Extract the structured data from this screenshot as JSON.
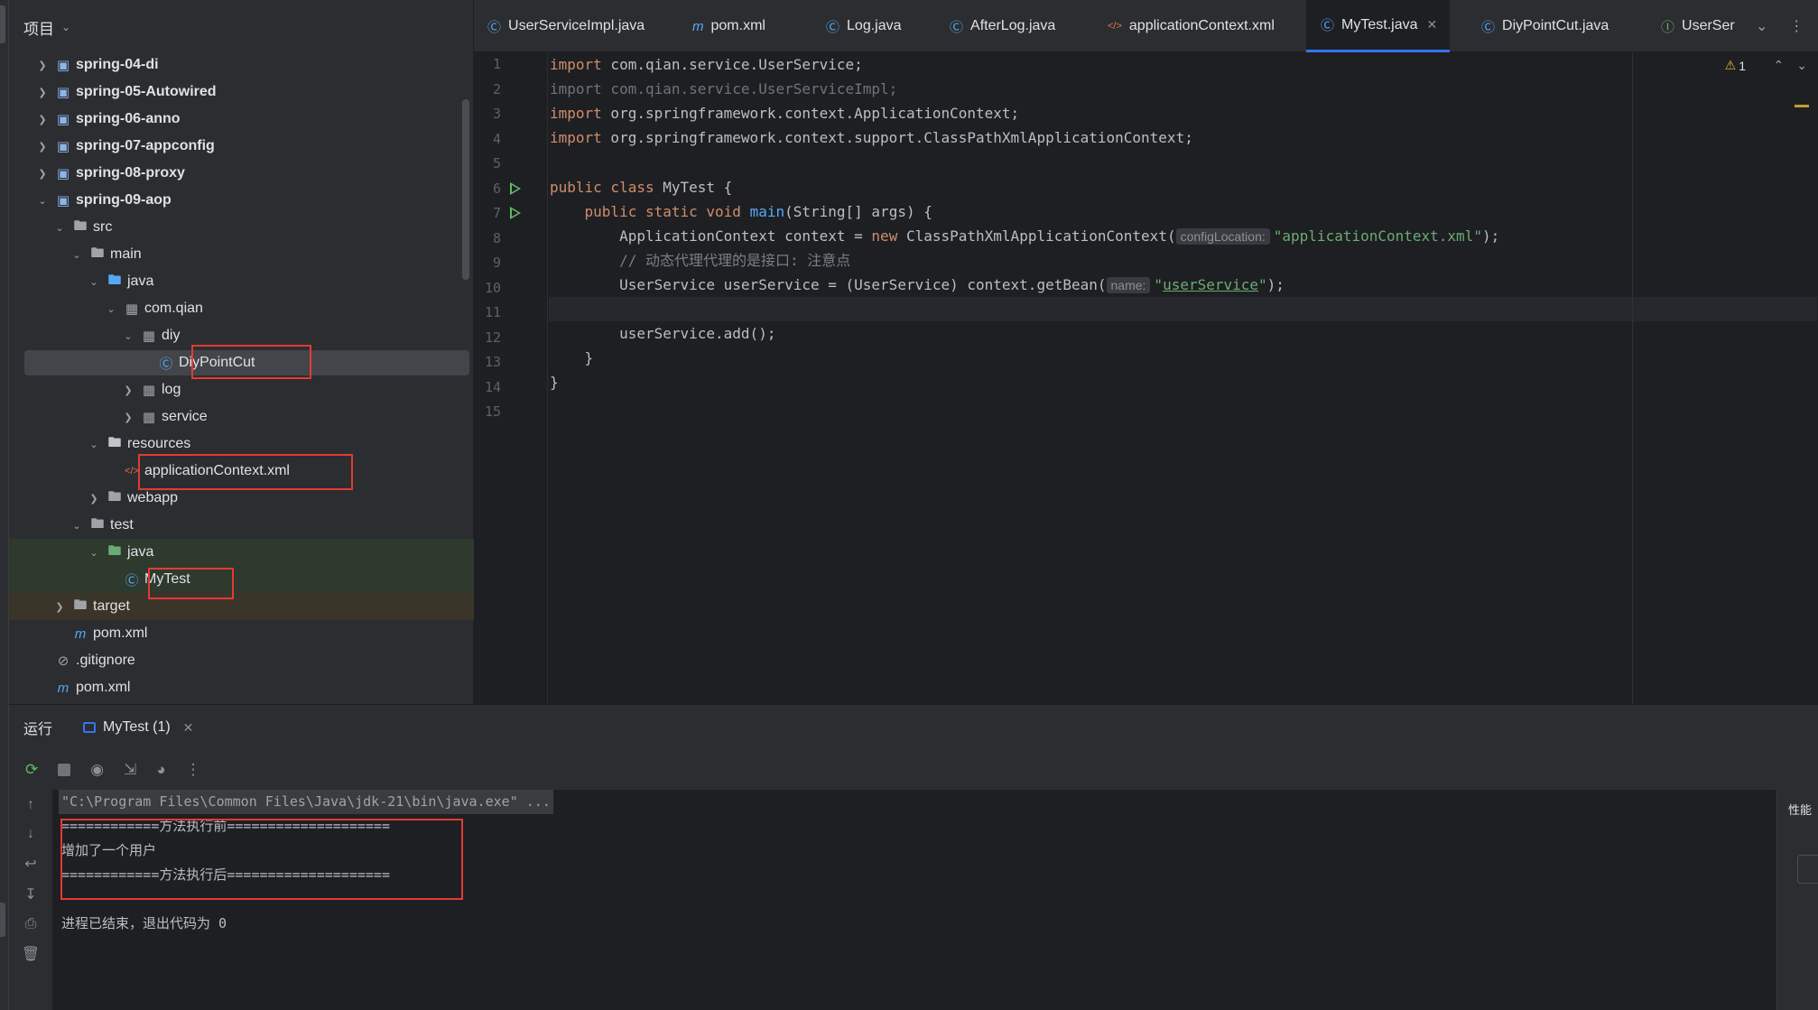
{
  "project": {
    "title": "项目",
    "tree": [
      {
        "label": "spring-04-di",
        "bold": true,
        "indent": 0,
        "arrow": "right",
        "icon": "module-icon"
      },
      {
        "label": "spring-05-Autowired",
        "bold": true,
        "indent": 0,
        "arrow": "right",
        "icon": "module-icon"
      },
      {
        "label": "spring-06-anno",
        "bold": true,
        "indent": 0,
        "arrow": "right",
        "icon": "module-icon"
      },
      {
        "label": "spring-07-appconfig",
        "bold": true,
        "indent": 0,
        "arrow": "right",
        "icon": "module-icon"
      },
      {
        "label": "spring-08-proxy",
        "bold": true,
        "indent": 0,
        "arrow": "right",
        "icon": "module-icon"
      },
      {
        "label": "spring-09-aop",
        "bold": true,
        "indent": 0,
        "arrow": "down",
        "icon": "module-icon"
      },
      {
        "label": "src",
        "indent": 1,
        "arrow": "down",
        "icon": "folder-icon"
      },
      {
        "label": "main",
        "indent": 2,
        "arrow": "down",
        "icon": "folder-icon"
      },
      {
        "label": "java",
        "indent": 3,
        "arrow": "down",
        "icon": "source-folder-icon"
      },
      {
        "label": "com.qian",
        "indent": 4,
        "arrow": "down",
        "icon": "package-icon"
      },
      {
        "label": "diy",
        "indent": 5,
        "arrow": "down",
        "icon": "package-icon"
      },
      {
        "label": "DiyPointCut",
        "indent": 6,
        "arrow": "",
        "icon": "java-class-icon",
        "selected": true
      },
      {
        "label": "log",
        "indent": 5,
        "arrow": "right",
        "icon": "package-icon"
      },
      {
        "label": "service",
        "indent": 5,
        "arrow": "right",
        "icon": "package-icon"
      },
      {
        "label": "resources",
        "indent": 3,
        "arrow": "down",
        "icon": "resources-folder-icon"
      },
      {
        "label": "applicationContext.xml",
        "indent": 4,
        "arrow": "",
        "icon": "xml-file-icon"
      },
      {
        "label": "webapp",
        "indent": 3,
        "arrow": "right",
        "icon": "web-folder-icon"
      },
      {
        "label": "test",
        "indent": 2,
        "arrow": "down",
        "icon": "folder-icon"
      },
      {
        "label": "java",
        "indent": 3,
        "arrow": "down",
        "icon": "test-folder-icon",
        "tint": "green"
      },
      {
        "label": "MyTest",
        "indent": 4,
        "arrow": "",
        "icon": "java-test-class-icon",
        "tint": "green"
      },
      {
        "label": "target",
        "indent": 1,
        "arrow": "right",
        "icon": "folder-icon",
        "tint": "brown"
      },
      {
        "label": "pom.xml",
        "indent": 1,
        "arrow": "",
        "icon": "maven-icon"
      },
      {
        "label": ".gitignore",
        "indent": 0,
        "arrow": "",
        "icon": "ignore-file-icon"
      },
      {
        "label": "pom.xml",
        "indent": 0,
        "arrow": "",
        "icon": "maven-icon"
      }
    ]
  },
  "tabs": [
    {
      "label": "UserServiceImpl.java",
      "icon": "java-class-icon"
    },
    {
      "label": "pom.xml",
      "icon": "maven-icon"
    },
    {
      "label": "Log.java",
      "icon": "java-class-icon"
    },
    {
      "label": "AfterLog.java",
      "icon": "java-class-icon"
    },
    {
      "label": "applicationContext.xml",
      "icon": "xml-file-icon"
    },
    {
      "label": "MyTest.java",
      "icon": "java-test-class-icon",
      "active": true
    },
    {
      "label": "DiyPointCut.java",
      "icon": "java-class-icon"
    },
    {
      "label": "UserSer",
      "icon": "interface-icon"
    }
  ],
  "editor": {
    "warning_count": "1",
    "line_numbers": [
      "1",
      "2",
      "3",
      "4",
      "5",
      "6",
      "7",
      "8",
      "9",
      "10",
      "11",
      "12",
      "13",
      "14",
      "15"
    ],
    "hint_config": "configLocation:",
    "hint_name": "name:",
    "comment": "// 动态代理代理的是接口: 注意点"
  },
  "run": {
    "title": "运行",
    "tab_label": "MyTest (1)",
    "perf_label": "性能",
    "output": [
      "\"C:\\Program Files\\Common Files\\Java\\jdk-21\\bin\\java.exe\" ...",
      "============方法执行前====================",
      "增加了一个用户",
      "============方法执行后====================",
      "",
      "进程已结束，退出代码为 0"
    ]
  },
  "colors": {
    "accent": "#3574f0",
    "highlight_box": "#e53935",
    "run_green": "#5fb865"
  }
}
